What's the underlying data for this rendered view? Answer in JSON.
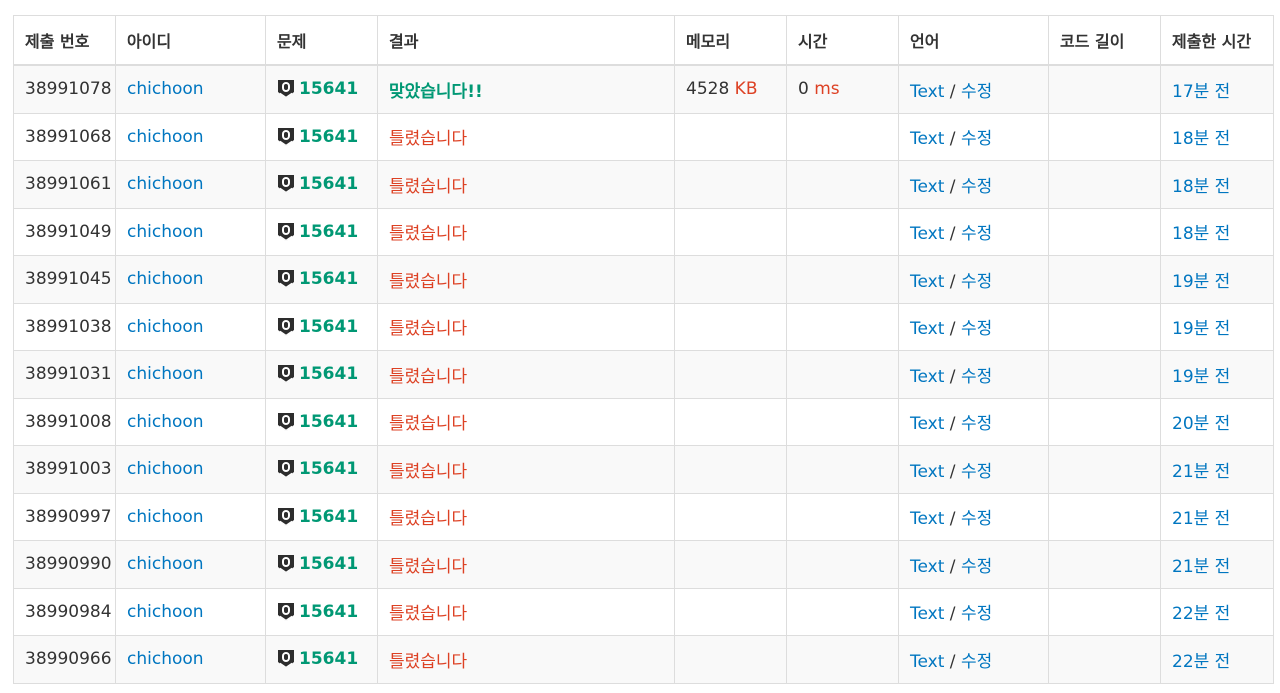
{
  "columns": [
    "제출 번호",
    "아이디",
    "문제",
    "결과",
    "메모리",
    "시간",
    "언어",
    "코드 길이",
    "제출한 시간"
  ],
  "colors": {
    "link": "#0076c0",
    "accepted": "#009874",
    "wrong": "#dd4124",
    "unit": "#dd4124"
  },
  "tier_icon": "unrated-tier-icon",
  "rows": [
    {
      "id": "38991078",
      "user": "chichoon",
      "problem": "15641",
      "result": "맞았습니다!!",
      "result_type": "ac",
      "memory": "4528",
      "memory_unit": "KB",
      "time": "0",
      "time_unit": "ms",
      "lang": "Text",
      "edit": "수정",
      "length": "",
      "submitted": "17분 전"
    },
    {
      "id": "38991068",
      "user": "chichoon",
      "problem": "15641",
      "result": "틀렸습니다",
      "result_type": "wa",
      "memory": "",
      "memory_unit": "",
      "time": "",
      "time_unit": "",
      "lang": "Text",
      "edit": "수정",
      "length": "",
      "submitted": "18분 전"
    },
    {
      "id": "38991061",
      "user": "chichoon",
      "problem": "15641",
      "result": "틀렸습니다",
      "result_type": "wa",
      "memory": "",
      "memory_unit": "",
      "time": "",
      "time_unit": "",
      "lang": "Text",
      "edit": "수정",
      "length": "",
      "submitted": "18분 전"
    },
    {
      "id": "38991049",
      "user": "chichoon",
      "problem": "15641",
      "result": "틀렸습니다",
      "result_type": "wa",
      "memory": "",
      "memory_unit": "",
      "time": "",
      "time_unit": "",
      "lang": "Text",
      "edit": "수정",
      "length": "",
      "submitted": "18분 전"
    },
    {
      "id": "38991045",
      "user": "chichoon",
      "problem": "15641",
      "result": "틀렸습니다",
      "result_type": "wa",
      "memory": "",
      "memory_unit": "",
      "time": "",
      "time_unit": "",
      "lang": "Text",
      "edit": "수정",
      "length": "",
      "submitted": "19분 전"
    },
    {
      "id": "38991038",
      "user": "chichoon",
      "problem": "15641",
      "result": "틀렸습니다",
      "result_type": "wa",
      "memory": "",
      "memory_unit": "",
      "time": "",
      "time_unit": "",
      "lang": "Text",
      "edit": "수정",
      "length": "",
      "submitted": "19분 전"
    },
    {
      "id": "38991031",
      "user": "chichoon",
      "problem": "15641",
      "result": "틀렸습니다",
      "result_type": "wa",
      "memory": "",
      "memory_unit": "",
      "time": "",
      "time_unit": "",
      "lang": "Text",
      "edit": "수정",
      "length": "",
      "submitted": "19분 전"
    },
    {
      "id": "38991008",
      "user": "chichoon",
      "problem": "15641",
      "result": "틀렸습니다",
      "result_type": "wa",
      "memory": "",
      "memory_unit": "",
      "time": "",
      "time_unit": "",
      "lang": "Text",
      "edit": "수정",
      "length": "",
      "submitted": "20분 전"
    },
    {
      "id": "38991003",
      "user": "chichoon",
      "problem": "15641",
      "result": "틀렸습니다",
      "result_type": "wa",
      "memory": "",
      "memory_unit": "",
      "time": "",
      "time_unit": "",
      "lang": "Text",
      "edit": "수정",
      "length": "",
      "submitted": "21분 전"
    },
    {
      "id": "38990997",
      "user": "chichoon",
      "problem": "15641",
      "result": "틀렸습니다",
      "result_type": "wa",
      "memory": "",
      "memory_unit": "",
      "time": "",
      "time_unit": "",
      "lang": "Text",
      "edit": "수정",
      "length": "",
      "submitted": "21분 전"
    },
    {
      "id": "38990990",
      "user": "chichoon",
      "problem": "15641",
      "result": "틀렸습니다",
      "result_type": "wa",
      "memory": "",
      "memory_unit": "",
      "time": "",
      "time_unit": "",
      "lang": "Text",
      "edit": "수정",
      "length": "",
      "submitted": "21분 전"
    },
    {
      "id": "38990984",
      "user": "chichoon",
      "problem": "15641",
      "result": "틀렸습니다",
      "result_type": "wa",
      "memory": "",
      "memory_unit": "",
      "time": "",
      "time_unit": "",
      "lang": "Text",
      "edit": "수정",
      "length": "",
      "submitted": "22분 전"
    },
    {
      "id": "38990966",
      "user": "chichoon",
      "problem": "15641",
      "result": "틀렸습니다",
      "result_type": "wa",
      "memory": "",
      "memory_unit": "",
      "time": "",
      "time_unit": "",
      "lang": "Text",
      "edit": "수정",
      "length": "",
      "submitted": "22분 전"
    }
  ]
}
